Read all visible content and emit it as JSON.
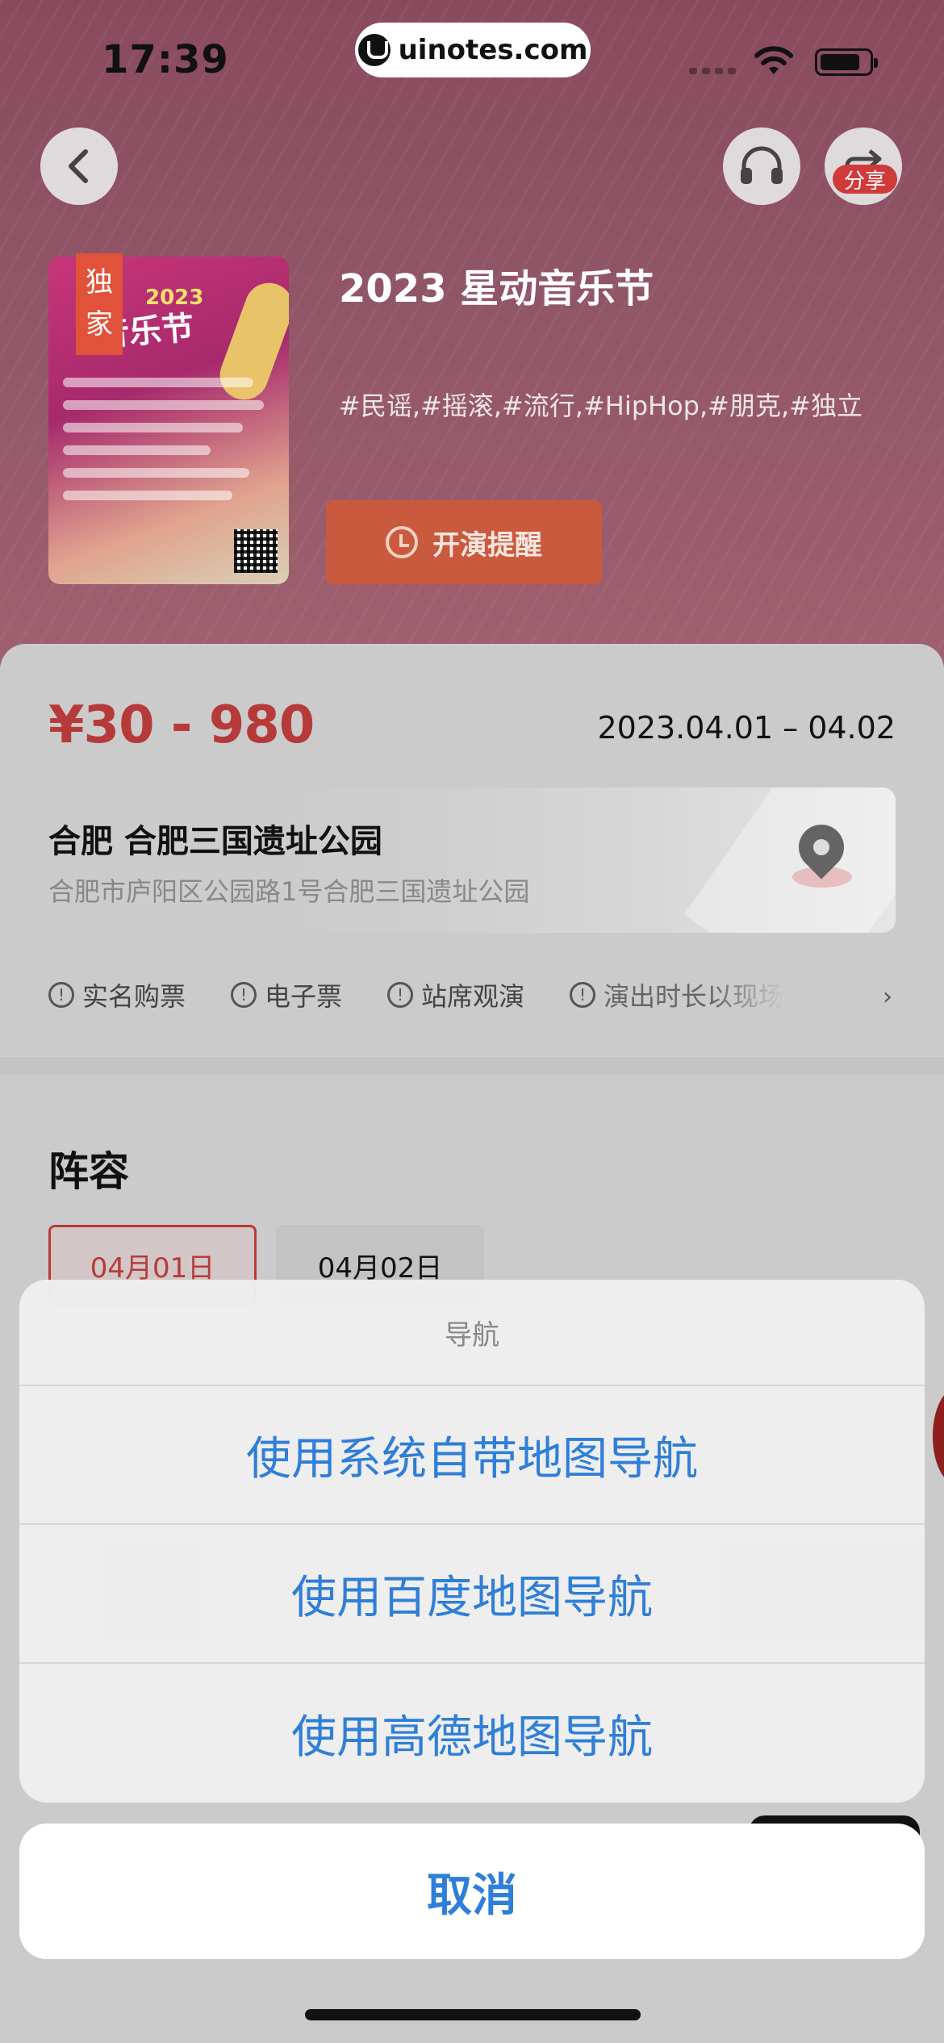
{
  "status_bar": {
    "time": "17:39",
    "url": "uinotes.com"
  },
  "header": {
    "share_badge": "分享",
    "exclusive_badge": "独家",
    "poster": {
      "year": "2023",
      "title": "音乐节"
    },
    "event_title": "2023 星动音乐节",
    "tags": "#民谣,#摇滚,#流行,#HipHop,#朋克,#独立",
    "remind_label": "开演提醒"
  },
  "info": {
    "price": "¥30 - 980",
    "date": "2023.04.01 – 04.02",
    "venue_city": "合肥 合肥三国遗址公园",
    "venue_address": "合肥市庐阳区公园路1号合肥三国遗址公园",
    "notes": [
      "实名购票",
      "电子票",
      "站席观演",
      "演出时长以现场"
    ]
  },
  "lineup": {
    "title": "阵容",
    "days": [
      "04月01日",
      "04月02日"
    ]
  },
  "action_sheet": {
    "title": "导航",
    "options": [
      "使用系统自带地图导航",
      "使用百度地图导航",
      "使用高德地图导航"
    ],
    "cancel": "取消"
  },
  "colors": {
    "accent_red": "#b73a3a",
    "link_blue": "#2f7ed8",
    "remind_orange": "#c95a3e"
  }
}
